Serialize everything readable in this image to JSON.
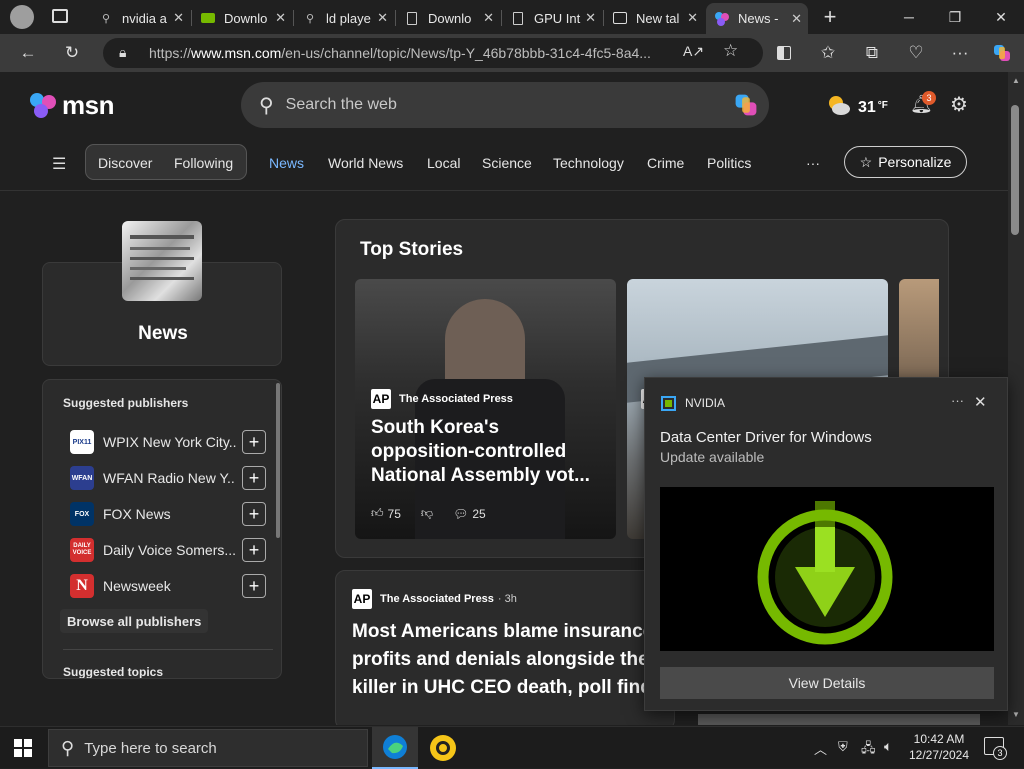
{
  "browser": {
    "tabs": [
      {
        "title": "nvidia a",
        "icon": "search-icon",
        "active": false
      },
      {
        "title": "Downlo",
        "icon": "nvidia-icon",
        "active": false
      },
      {
        "title": "ld playe",
        "icon": "search-icon",
        "active": false
      },
      {
        "title": "Downlo",
        "icon": "page-icon",
        "active": false
      },
      {
        "title": "GPU Int",
        "icon": "page-icon",
        "active": false
      },
      {
        "title": "New tal",
        "icon": "newtab-icon",
        "active": false
      },
      {
        "title": "News -",
        "icon": "msn-icon",
        "active": true
      }
    ],
    "url_prefix": "https://",
    "url_domain": "www.msn.com",
    "url_rest": "/en-us/channel/topic/News/tp-Y_46b78bbb-31c4-4fc5-8a4..."
  },
  "msn": {
    "logo_text": "msn",
    "search_placeholder": "Search the web",
    "weather_temp": "31",
    "weather_unit": "°F",
    "notification_count": "3",
    "nav": {
      "discover": "Discover",
      "following": "Following",
      "items": [
        "News",
        "World News",
        "Local",
        "Science",
        "Technology",
        "Crime",
        "Politics"
      ],
      "more": "···",
      "personalize": "Personalize"
    },
    "topic_title": "News",
    "suggested_publishers_heading": "Suggested publishers",
    "publishers": [
      {
        "name": "WPIX New York City...",
        "logo": "PIX11",
        "color": "#1a3a8a"
      },
      {
        "name": "WFAN Radio New Y...",
        "logo": "WFAN",
        "color": "#c0392b"
      },
      {
        "name": "FOX News",
        "logo": "FOX",
        "color": "#003366"
      },
      {
        "name": "Daily Voice Somers...",
        "logo": "DAILY VOICE",
        "color": "#d32f2f"
      },
      {
        "name": "Newsweek",
        "logo": "N",
        "color": "#d32f2f"
      }
    ],
    "browse_all": "Browse all publishers",
    "suggested_topics": "Suggested topics",
    "top_stories_heading": "Top Stories",
    "story1": {
      "source": "The Associated Press",
      "headline": "South Korea's opposition-controlled National Assembly vot...",
      "likes": "75",
      "comments": "25"
    },
    "feed_story": {
      "source": "The Associated Press",
      "age": "· 3h",
      "headline_lines": [
        "Most Americans blame insurance",
        "profits and denials alongside the",
        "killer in UHC CEO death, poll find"
      ]
    }
  },
  "toast": {
    "app": "NVIDIA",
    "title": "Data Center Driver for Windows",
    "subtitle": "Update available",
    "button": "View Details",
    "more": "···"
  },
  "taskbar": {
    "search_placeholder": "Type here to search",
    "time": "10:42 AM",
    "date": "12/27/2024",
    "notifications": "3"
  }
}
